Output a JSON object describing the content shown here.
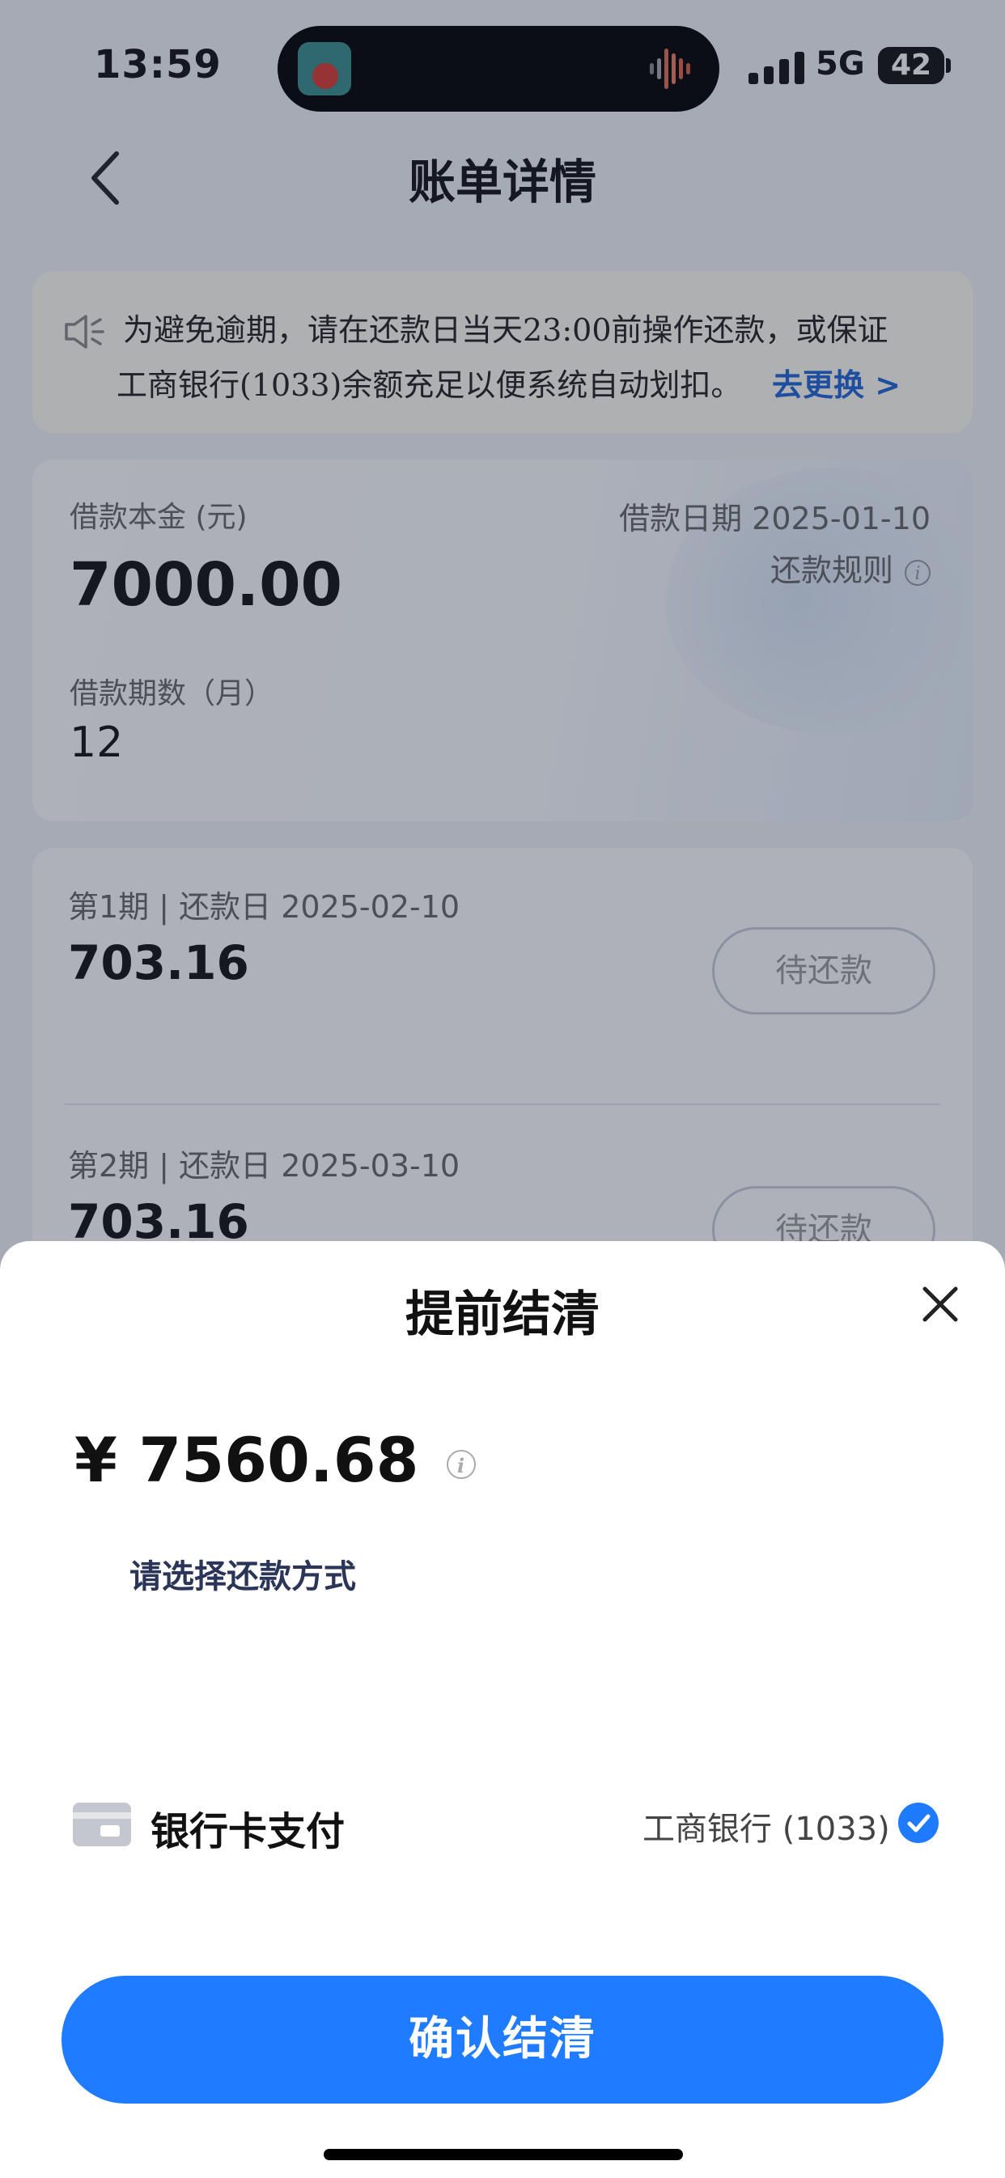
{
  "status_bar": {
    "time": "13:59",
    "network": "5G",
    "battery": "42"
  },
  "header": {
    "title": "账单详情"
  },
  "notice": {
    "line1": "为避免逾期，请在还款日当天23:00前操作还款，或保证",
    "line2": "工商银行(1033)余额充足以便系统自动划扣。",
    "link": "去更换 >"
  },
  "loan": {
    "principal_label": "借款本金 (元)",
    "principal_value": "7000.00",
    "date_label": "借款日期 2025-01-10",
    "rules_label": "还款规则",
    "term_label": "借款期数（月）",
    "term_value": "12"
  },
  "installments": [
    {
      "label": "第1期 | 还款日 2025-02-10",
      "amount": "703.16",
      "status": "待还款"
    },
    {
      "label": "第2期 | 还款日 2025-03-10",
      "amount": "703.16",
      "status": "待还款"
    }
  ],
  "sheet": {
    "title": "提前结清",
    "amount": "¥ 7560.68",
    "prompt": "请选择还款方式",
    "pay_method": "银行卡支付",
    "bank": "工商银行 (1033)",
    "confirm": "确认结清"
  },
  "icons": {
    "back": "chevron-left-icon",
    "horn": "speaker-icon",
    "info": "info-icon",
    "close": "close-icon",
    "card": "bank-card-icon",
    "check": "check-circle-icon"
  },
  "colors": {
    "accent": "#1f7bff",
    "link": "#1f64d6",
    "check": "#1e7bff"
  }
}
